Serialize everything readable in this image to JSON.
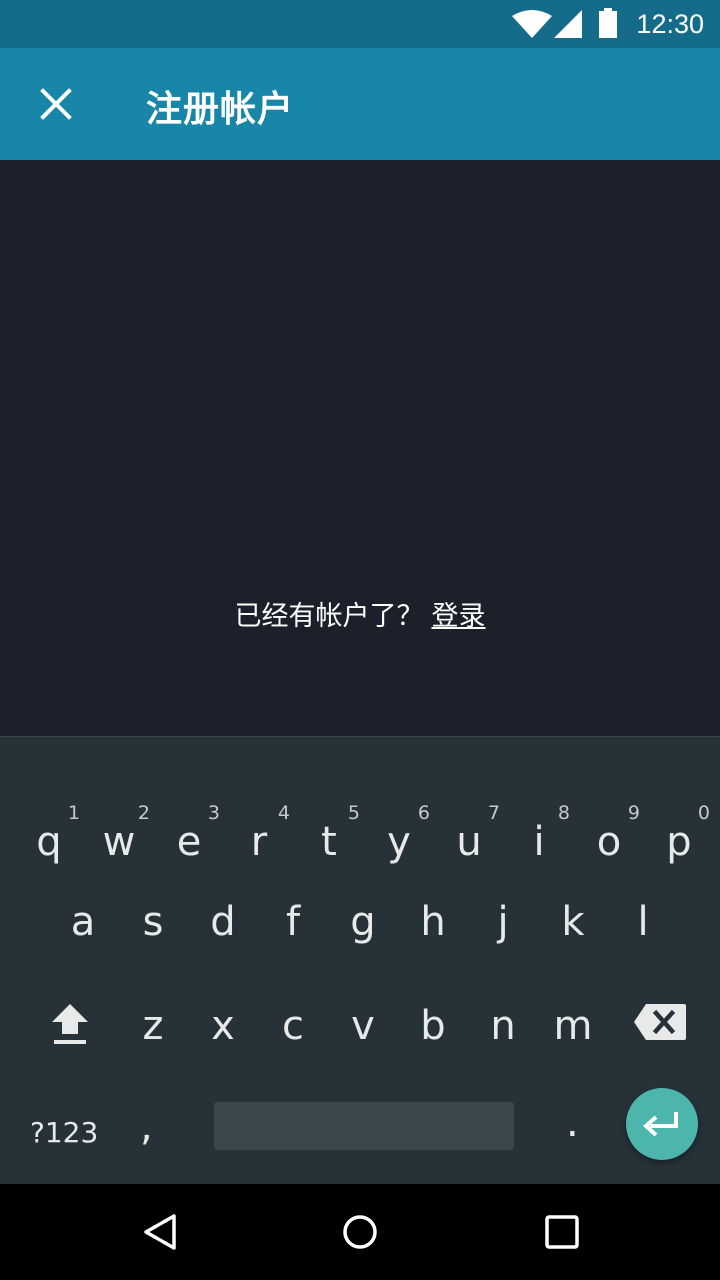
{
  "status_bar": {
    "time": "12:30",
    "icons": [
      "wifi-icon",
      "signal-icon",
      "battery-icon"
    ]
  },
  "app_bar": {
    "title": "注册帐户",
    "close_icon": "close-icon",
    "color": "#1786a8"
  },
  "content": {
    "prompt": "已经有帐户了？",
    "login_link": "登录"
  },
  "keyboard": {
    "row1": [
      {
        "key": "q",
        "hint": "1"
      },
      {
        "key": "w",
        "hint": "2"
      },
      {
        "key": "e",
        "hint": "3"
      },
      {
        "key": "r",
        "hint": "4"
      },
      {
        "key": "t",
        "hint": "5"
      },
      {
        "key": "y",
        "hint": "6"
      },
      {
        "key": "u",
        "hint": "7"
      },
      {
        "key": "i",
        "hint": "8"
      },
      {
        "key": "o",
        "hint": "9"
      },
      {
        "key": "p",
        "hint": "0"
      }
    ],
    "row2": [
      "a",
      "s",
      "d",
      "f",
      "g",
      "h",
      "j",
      "k",
      "l"
    ],
    "row3": [
      "z",
      "x",
      "c",
      "v",
      "b",
      "n",
      "m"
    ],
    "symbols_label": "?123",
    "comma": ",",
    "period": ".",
    "enter_color": "#4db6ac"
  },
  "nav_bar": {
    "icons": [
      "back-icon",
      "home-icon",
      "recents-icon"
    ]
  }
}
